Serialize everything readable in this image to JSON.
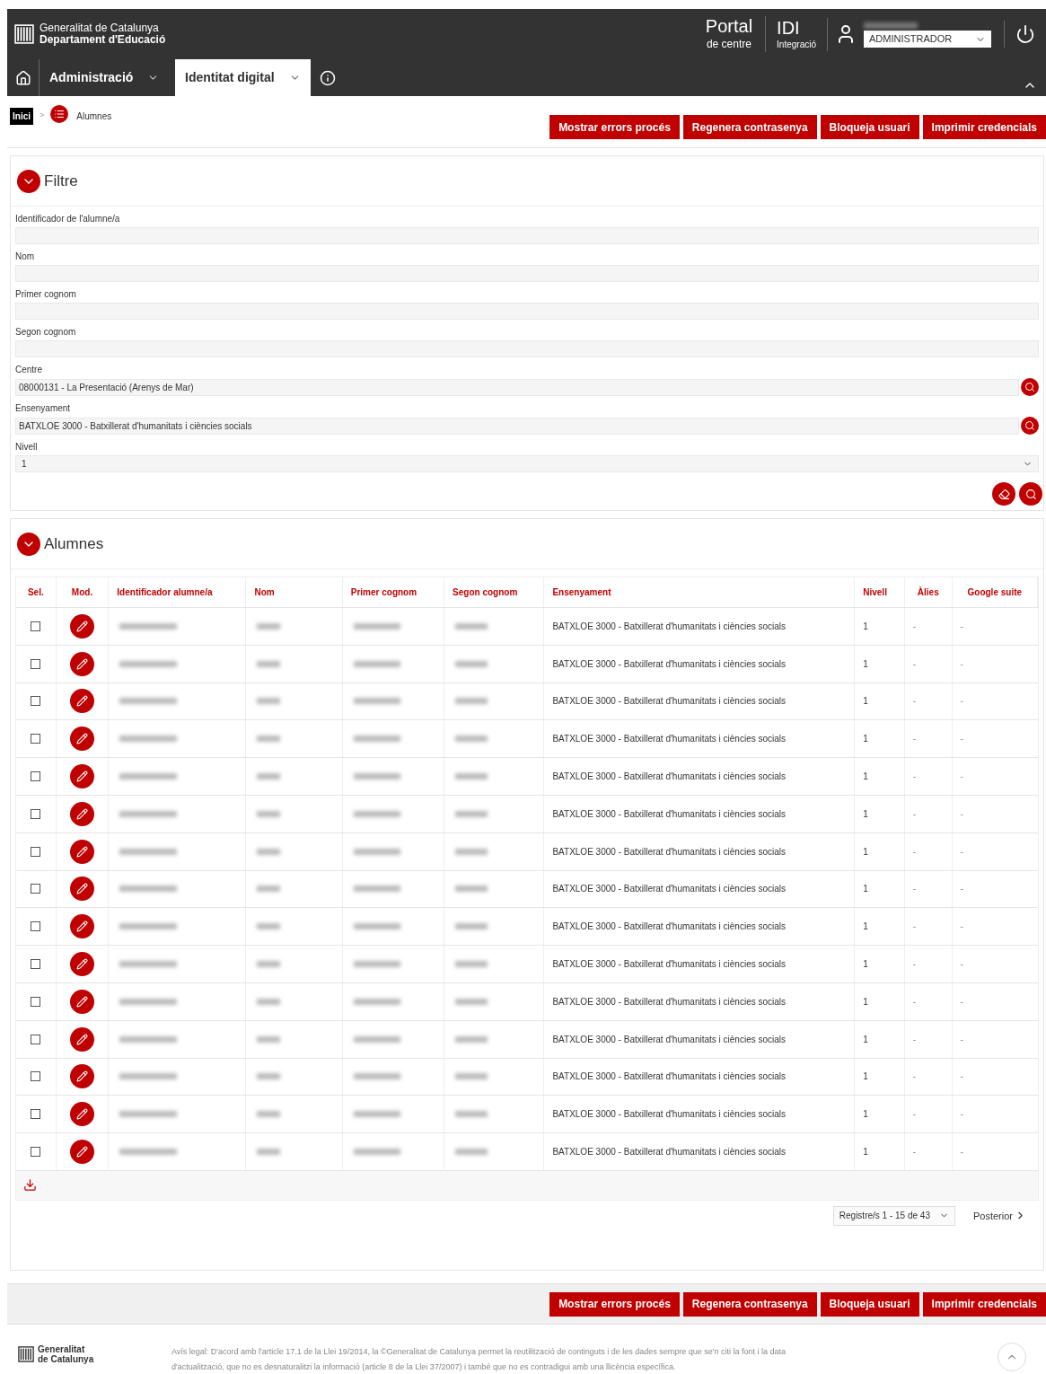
{
  "header": {
    "org_line1": "Generalitat de Catalunya",
    "org_line2": "Departament d'Educació",
    "portal_title": "Portal",
    "portal_sub": "de centre",
    "app_title": "IDI",
    "app_sub": "Integració",
    "role": "ADMINISTRADOR"
  },
  "nav": {
    "tabs": [
      {
        "label": "Administració",
        "selected": false
      },
      {
        "label": "Identitat digital",
        "selected": true
      }
    ]
  },
  "breadcrumb": {
    "root": "Inici",
    "separator": ">",
    "current": "Alumnes"
  },
  "top_actions": [
    "Mostrar errors procés",
    "Regenera contrasenya",
    "Bloqueja usuari",
    "Imprimir credencials"
  ],
  "bottom_actions": [
    "Mostrar errors procés",
    "Regenera contrasenya",
    "Bloqueja usuari",
    "Imprimir credencials"
  ],
  "filter": {
    "title": "Filtre",
    "fields": [
      {
        "label": "Identificador de l'alumne/a",
        "kind": "text"
      },
      {
        "label": "Nom",
        "kind": "text"
      },
      {
        "label": "Primer cognom",
        "kind": "text"
      },
      {
        "label": "Segon cognom",
        "kind": "text"
      },
      {
        "label": "Centre",
        "kind": "lookup",
        "value": "08000131 -  La Presentació (Arenys de Mar)"
      },
      {
        "label": "Ensenyament",
        "kind": "lookup",
        "value": "BATXLOE 3000 - Batxillerat d'humanitats i ciències socials"
      },
      {
        "label": "Nivell",
        "kind": "select",
        "value": "1"
      }
    ]
  },
  "table": {
    "title": "Alumnes",
    "columns": [
      "Sel.",
      "Mod.",
      "Identificador alumne/a",
      "Nom",
      "Primer cognom",
      "Segon cognom",
      "Ensenyament",
      "Nivell",
      "Àlies",
      "Google suite"
    ],
    "rows": [
      {
        "checked": false,
        "ensenyament": "BATXLOE 3000 - Batxillerat d'humanitats i ciències socials",
        "nivell": "1",
        "alies": "-",
        "google": "-"
      },
      {
        "checked": false,
        "ensenyament": "BATXLOE 3000 - Batxillerat d'humanitats i ciències socials",
        "nivell": "1",
        "alies": "-",
        "google": "-"
      },
      {
        "checked": false,
        "ensenyament": "BATXLOE 3000 - Batxillerat d'humanitats i ciències socials",
        "nivell": "1",
        "alies": "-",
        "google": "-"
      },
      {
        "checked": false,
        "ensenyament": "BATXLOE 3000 - Batxillerat d'humanitats i ciències socials",
        "nivell": "1",
        "alies": "-",
        "google": "-"
      },
      {
        "checked": false,
        "ensenyament": "BATXLOE 3000 - Batxillerat d'humanitats i ciències socials",
        "nivell": "1",
        "alies": "-",
        "google": "-"
      },
      {
        "checked": false,
        "ensenyament": "BATXLOE 3000 - Batxillerat d'humanitats i ciències socials",
        "nivell": "1",
        "alies": "-",
        "google": "-"
      },
      {
        "checked": false,
        "ensenyament": "BATXLOE 3000 - Batxillerat d'humanitats i ciències socials",
        "nivell": "1",
        "alies": "-",
        "google": "-"
      },
      {
        "checked": false,
        "ensenyament": "BATXLOE 3000 - Batxillerat d'humanitats i ciències socials",
        "nivell": "1",
        "alies": "-",
        "google": "-"
      },
      {
        "checked": false,
        "ensenyament": "BATXLOE 3000 - Batxillerat d'humanitats i ciències socials",
        "nivell": "1",
        "alies": "-",
        "google": "-"
      },
      {
        "checked": false,
        "ensenyament": "BATXLOE 3000 - Batxillerat d'humanitats i ciències socials",
        "nivell": "1",
        "alies": "-",
        "google": "-"
      },
      {
        "checked": false,
        "ensenyament": "BATXLOE 3000 - Batxillerat d'humanitats i ciències socials",
        "nivell": "1",
        "alies": "-",
        "google": "-"
      },
      {
        "checked": false,
        "ensenyament": "BATXLOE 3000 - Batxillerat d'humanitats i ciències socials",
        "nivell": "1",
        "alies": "-",
        "google": "-"
      },
      {
        "checked": false,
        "ensenyament": "BATXLOE 3000 - Batxillerat d'humanitats i ciències socials",
        "nivell": "1",
        "alies": "-",
        "google": "-"
      },
      {
        "checked": false,
        "ensenyament": "BATXLOE 3000 - Batxillerat d'humanitats i ciències socials",
        "nivell": "1",
        "alies": "-",
        "google": "-"
      },
      {
        "checked": false,
        "ensenyament": "BATXLOE 3000 - Batxillerat d'humanitats i ciències socials",
        "nivell": "1",
        "alies": "-",
        "google": "-"
      }
    ],
    "pagination": {
      "records": "Registre/s 1 - 15 de 43",
      "next": "Posterior"
    }
  },
  "footer": {
    "org_line1": "Generalitat",
    "org_line2": "de Catalunya",
    "legal_line1": "Avís legal: D'acord amb l'article 17.1 de la Llei 19/2014, la ©Generalitat de Catalunya permet la reutilització de continguts i de les dades sempre que se'n citi la font i la data",
    "legal_line2": "d'actualització, que no es desnaturalitzi la informació (article 8 de la Llei 37/2007) i també que no es contradigui amb una llicència específica."
  }
}
